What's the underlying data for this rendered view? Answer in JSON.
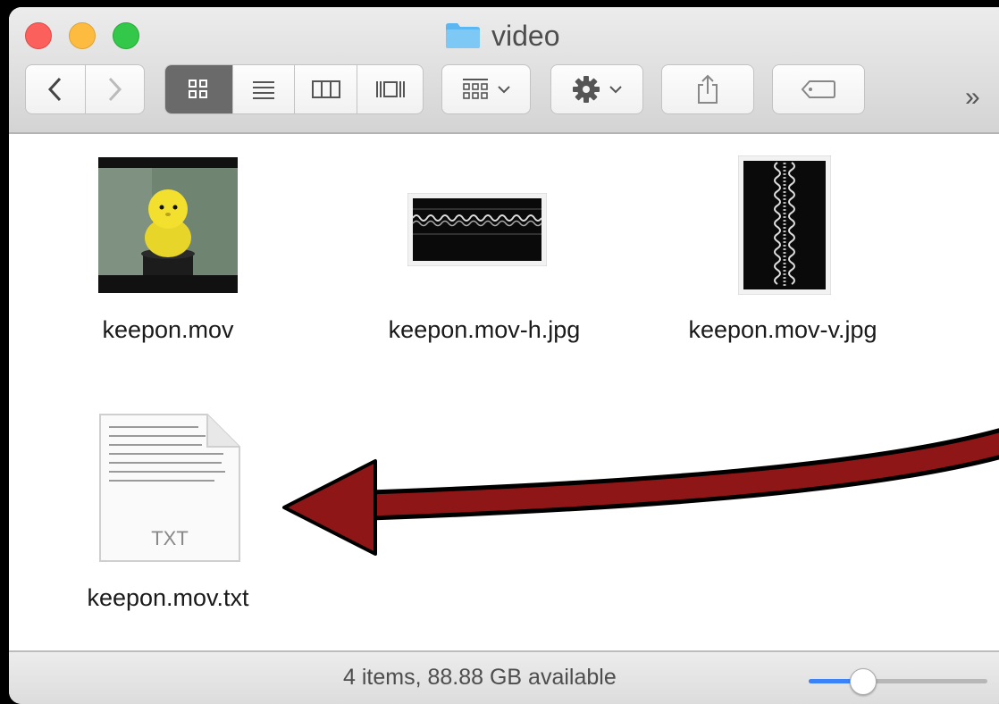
{
  "window": {
    "title": "video"
  },
  "files": [
    {
      "name": "keepon.mov",
      "type": "video"
    },
    {
      "name": "keepon.mov-h.jpg",
      "type": "image"
    },
    {
      "name": "keepon.mov-v.jpg",
      "type": "image"
    },
    {
      "name": "keepon.mov.txt",
      "type": "text",
      "badge": "TXT"
    }
  ],
  "status": {
    "text": "4 items, 88.88 GB available",
    "zoom_fraction": 0.3
  },
  "colors": {
    "arrow": "#8e1616",
    "folder": "#5cb6f0",
    "accent": "#3b82f6"
  },
  "icons": [
    "back-icon",
    "forward-icon",
    "icon-view-icon",
    "list-view-icon",
    "column-view-icon",
    "coverflow-view-icon",
    "arrange-icon",
    "gear-icon",
    "share-icon",
    "tag-icon",
    "overflow-chevrons-icon",
    "folder-icon"
  ],
  "toolbar": {
    "overflow": "»"
  }
}
